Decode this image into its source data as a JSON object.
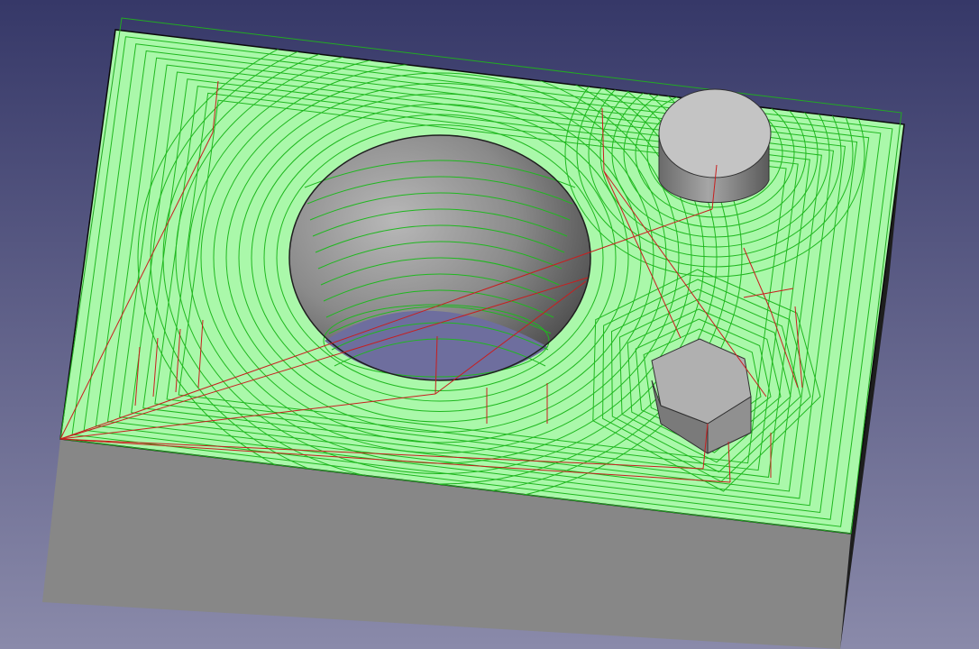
{
  "scene": {
    "view": "3d-viewport",
    "colors": {
      "background_top": "#363868",
      "background_bottom": "#8a8aaa",
      "stock_top": "#aaf8aa",
      "stock_front": "#878787",
      "stock_side": "#1e1e1e",
      "pocket_wall_dark": "#4a4a4a",
      "pocket_wall_light": "#b8b8b8",
      "pocket_floor": "#6e6e9e",
      "feed_path": "#1fb81f",
      "rapid_move": "#c81e1e",
      "boundary": "#22aa22",
      "cylinder_top": "#c4c4c4",
      "cylinder_side": "#8a8a8a",
      "hexagon_top": "#b0b0b0",
      "hexagon_side": "#7a7a7a"
    },
    "objects": [
      {
        "name": "stock-block",
        "kind": "box"
      },
      {
        "name": "circular-pocket",
        "kind": "hole"
      },
      {
        "name": "cylindrical-boss",
        "kind": "cylinder"
      },
      {
        "name": "hexagonal-boss",
        "kind": "hexagonal-prism"
      }
    ],
    "toolpath": {
      "operation": "adaptive-clearing",
      "feed_color_name": "green",
      "rapid_color_name": "red"
    }
  }
}
